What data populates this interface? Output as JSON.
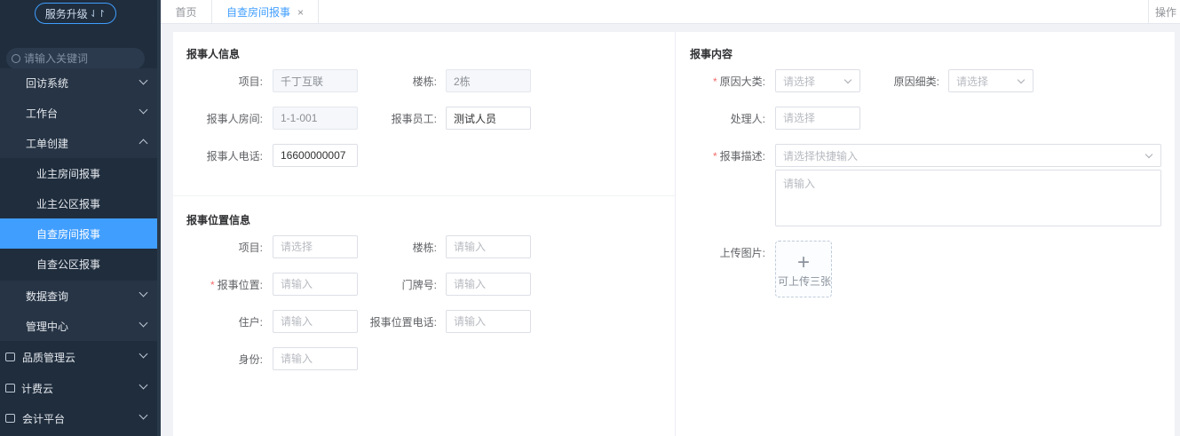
{
  "sidebar": {
    "upgrade_label": "服务升级",
    "upgrade_arrow": "⇃↾",
    "search_placeholder": "请输入关键词",
    "items": [
      {
        "label": "回访系统"
      },
      {
        "label": "工作台"
      },
      {
        "label": "工单创建"
      },
      {
        "label": "业主房间报事"
      },
      {
        "label": "业主公区报事"
      },
      {
        "label": "自查房间报事"
      },
      {
        "label": "自查公区报事"
      },
      {
        "label": "数据查询"
      },
      {
        "label": "管理中心"
      },
      {
        "label": "品质管理云"
      },
      {
        "label": "计费云"
      },
      {
        "label": "会计平台"
      }
    ]
  },
  "tabs": {
    "home": "首页",
    "current": "自查房间报事",
    "close": "×",
    "ops": "操作"
  },
  "reporter": {
    "title": "报事人信息",
    "project_label": "项目:",
    "project_value": "千丁互联",
    "building_label": "楼栋:",
    "building_value": "2栋",
    "room_label": "报事人房间:",
    "room_value": "1-1-001",
    "staff_label": "报事员工:",
    "staff_value": "测试人员",
    "phone_label": "报事人电话:",
    "phone_value": "16600000007"
  },
  "location": {
    "title": "报事位置信息",
    "project_label": "项目:",
    "project_placeholder": "请选择",
    "building_label": "楼栋:",
    "building_placeholder": "请输入",
    "position_label": "报事位置:",
    "position_placeholder": "请输入",
    "door_label": "门牌号:",
    "door_placeholder": "请输入",
    "resident_label": "住户:",
    "resident_placeholder": "请输入",
    "loc_phone_label": "报事位置电话:",
    "loc_phone_placeholder": "请输入",
    "identity_label": "身份:",
    "identity_placeholder": "请输入"
  },
  "content": {
    "title": "报事内容",
    "cause_major_label": "原因大类:",
    "cause_major_placeholder": "请选择",
    "cause_minor_label": "原因细类:",
    "cause_minor_placeholder": "请选择",
    "handler_label": "处理人:",
    "handler_placeholder": "请选择",
    "desc_label": "报事描述:",
    "desc_select_placeholder": "请选择快捷输入",
    "desc_textarea_placeholder": "请输入",
    "upload_label": "上传图片:",
    "upload_plus": "+",
    "upload_hint": "可上传三张"
  },
  "required_mark": "*",
  "colors": {
    "sidebar_bg": "#1f2d3d",
    "active_menu": "#409eff",
    "required": "#f56c6c"
  }
}
